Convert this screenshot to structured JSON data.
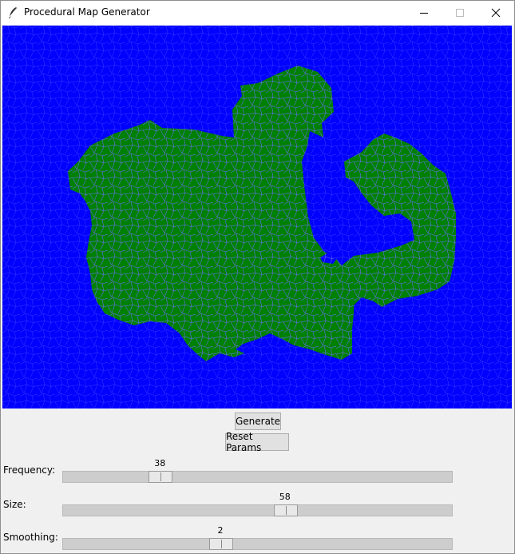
{
  "window": {
    "title": "Procedural Map Generator",
    "controls": [
      "minimize",
      "maximize",
      "close"
    ]
  },
  "map": {
    "ocean_color": "#0000ff",
    "land_color": "#008000",
    "cell_edge_color": "#6d6dff"
  },
  "buttons": {
    "generate": "Generate",
    "reset": "Reset Params"
  },
  "params": [
    {
      "label": "Frequency:",
      "value": 38,
      "fraction": 0.25
    },
    {
      "label": "Size:",
      "value": 58,
      "fraction": 0.57
    },
    {
      "label": "Smoothing:",
      "value": 2,
      "fraction": 0.405
    }
  ]
}
